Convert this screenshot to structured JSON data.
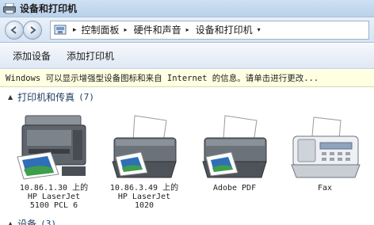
{
  "window": {
    "title": "设备和打印机"
  },
  "address": {
    "crumbs": [
      "控制面板",
      "硬件和声音",
      "设备和打印机"
    ]
  },
  "commands": {
    "add_device": "添加设备",
    "add_printer": "添加打印机"
  },
  "infobar": {
    "text": "Windows 可以显示增强型设备图标和来自 Internet 的信息。请单击进行更改..."
  },
  "groups": [
    {
      "title": "打印机和传真",
      "count": "(7)"
    },
    {
      "title": "设备",
      "count": "(3)"
    }
  ],
  "devices": [
    {
      "line1": "10.86.1.30 上的",
      "line2": "HP LaserJet",
      "line3": "5100 PCL 6",
      "icon": "multifunction-printer-icon"
    },
    {
      "line1": "10.86.3.49 上的",
      "line2": "HP LaserJet",
      "line3": "1020",
      "icon": "printer-icon"
    },
    {
      "line1": "Adobe PDF",
      "line2": "",
      "line3": "",
      "icon": "printer-icon"
    },
    {
      "line1": "Fax",
      "line2": "",
      "line3": "",
      "icon": "fax-icon"
    }
  ],
  "colors": {
    "accent": "#1e3a5f",
    "infobar": "#ffffe1"
  }
}
